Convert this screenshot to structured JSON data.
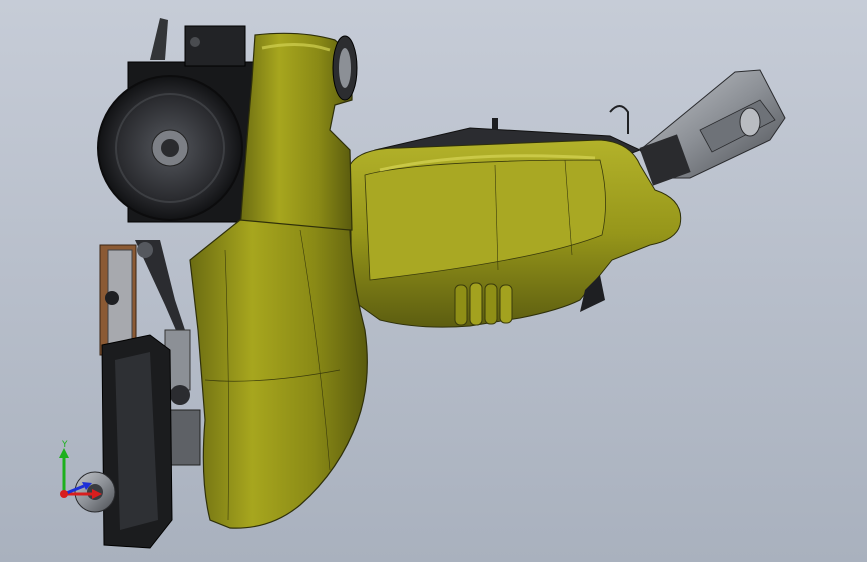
{
  "viewport": {
    "background_top": "#c6ccd7",
    "background_bottom": "#a9b1be"
  },
  "colors": {
    "housing_olive": "#a4a41c",
    "housing_dark": "#5a5c10",
    "housing_highlight": "#c9c84a",
    "metal_dark": "#1e1f22",
    "metal_mid": "#55585e",
    "metal_light": "#9ea2a8",
    "wood_plate": "#8b5a34",
    "axis_x": "#d81e1e",
    "axis_y": "#1cb01c",
    "axis_z": "#1c2fd8"
  },
  "triad": {
    "y_label": "Y",
    "x_label": "",
    "z_label": ""
  },
  "model": {
    "parts": [
      "upper-shroud",
      "lower-shroud",
      "flywheel",
      "motor-block",
      "side-tank",
      "handle-boot",
      "bellows",
      "cable-connector",
      "base-plate",
      "baseplate-wheel",
      "wooden-bracket",
      "lever-arm"
    ]
  }
}
